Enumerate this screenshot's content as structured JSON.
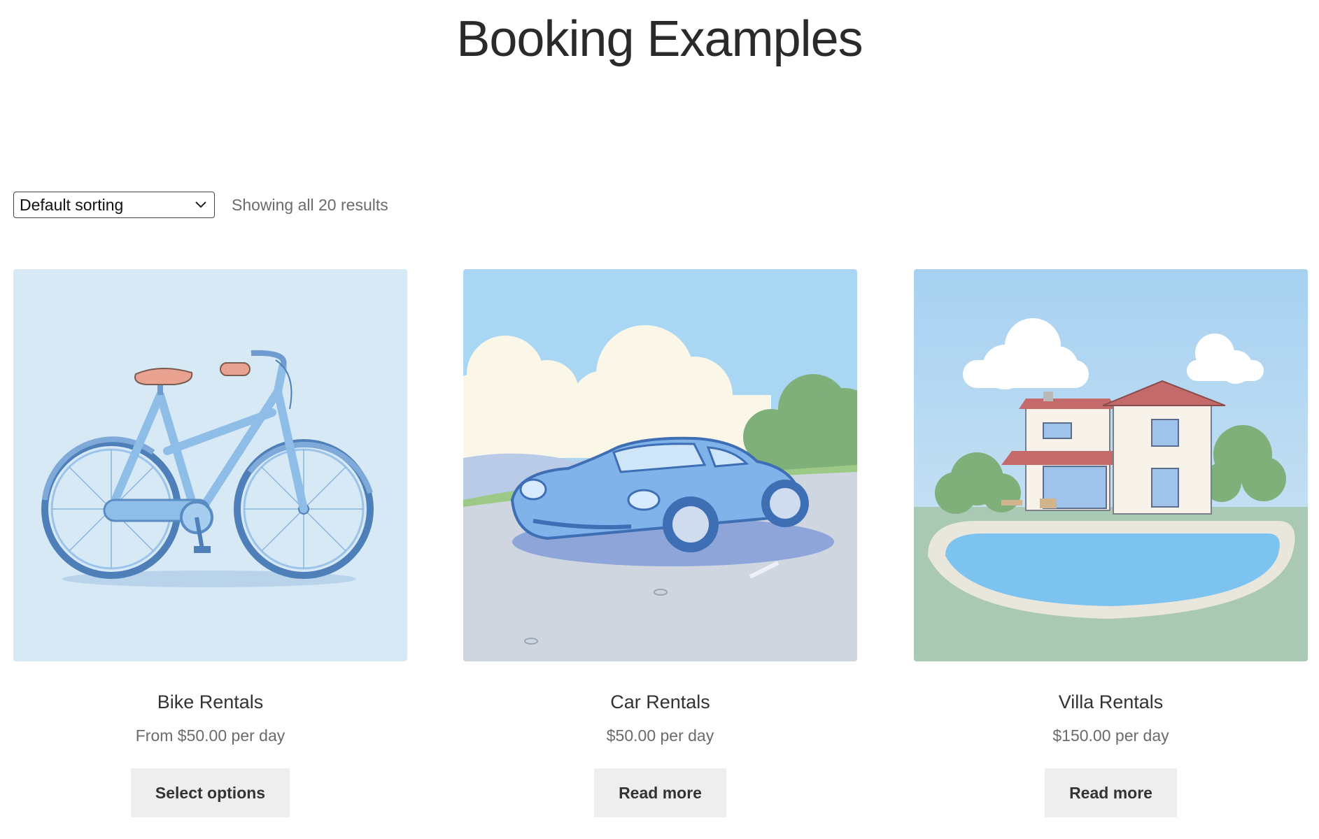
{
  "page": {
    "title": "Booking Examples"
  },
  "toolbar": {
    "sort_selected": "Default sorting",
    "result_count": "Showing all 20 results"
  },
  "products": [
    {
      "title": "Bike Rentals",
      "price": "From $50.00 per day",
      "button": "Select options",
      "image": "bicycle-illustration"
    },
    {
      "title": "Car Rentals",
      "price": "$50.00 per day",
      "button": "Read more",
      "image": "sports-car-illustration"
    },
    {
      "title": "Villa Rentals",
      "price": "$150.00 per day",
      "button": "Read more",
      "image": "villa-with-pool-illustration"
    }
  ],
  "colors": {
    "title_text": "#2a2a2a",
    "muted_text": "#6b6b6b",
    "button_bg": "#eeeeee",
    "bike_bg": "#d6e9f5",
    "sky": "#a9d6f2",
    "car_body": "#7fb3ea"
  }
}
